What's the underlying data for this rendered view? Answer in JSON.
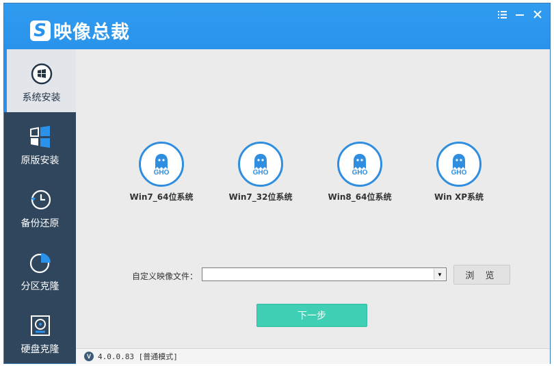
{
  "app": {
    "title": "映像总裁",
    "logo_letter": "S"
  },
  "window_controls": [
    {
      "name": "menu-icon",
      "glyph": "☰"
    },
    {
      "name": "minimize-icon",
      "glyph": "—"
    },
    {
      "name": "close-icon",
      "glyph": "✕"
    }
  ],
  "sidebar": {
    "items": [
      {
        "label": "系统安装",
        "icon": "windows-circle-icon",
        "active": true
      },
      {
        "label": "原版安装",
        "icon": "windows-logo-icon",
        "active": false
      },
      {
        "label": "备份还原",
        "icon": "history-clock-icon",
        "active": false
      },
      {
        "label": "分区克隆",
        "icon": "pie-chart-icon",
        "active": false
      },
      {
        "label": "硬盘克隆",
        "icon": "hard-disk-icon",
        "active": false
      }
    ]
  },
  "systems": [
    {
      "label": "Win7_64位系统",
      "badge": "GHO"
    },
    {
      "label": "Win7_32位系统",
      "badge": "GHO"
    },
    {
      "label": "Win8_64位系统",
      "badge": "GHO"
    },
    {
      "label": "Win XP系统",
      "badge": "GHO"
    }
  ],
  "custom_image": {
    "label": "自定义映像文件：",
    "value": "",
    "placeholder": ""
  },
  "buttons": {
    "browse": "浏 览",
    "next": "下一步"
  },
  "status": {
    "version_badge": "V",
    "text": "4.0.0.83 [普通模式]"
  },
  "colors": {
    "accent": "#2a92ea",
    "sidebar": "#30465c",
    "next_button": "#3ecfb4"
  }
}
